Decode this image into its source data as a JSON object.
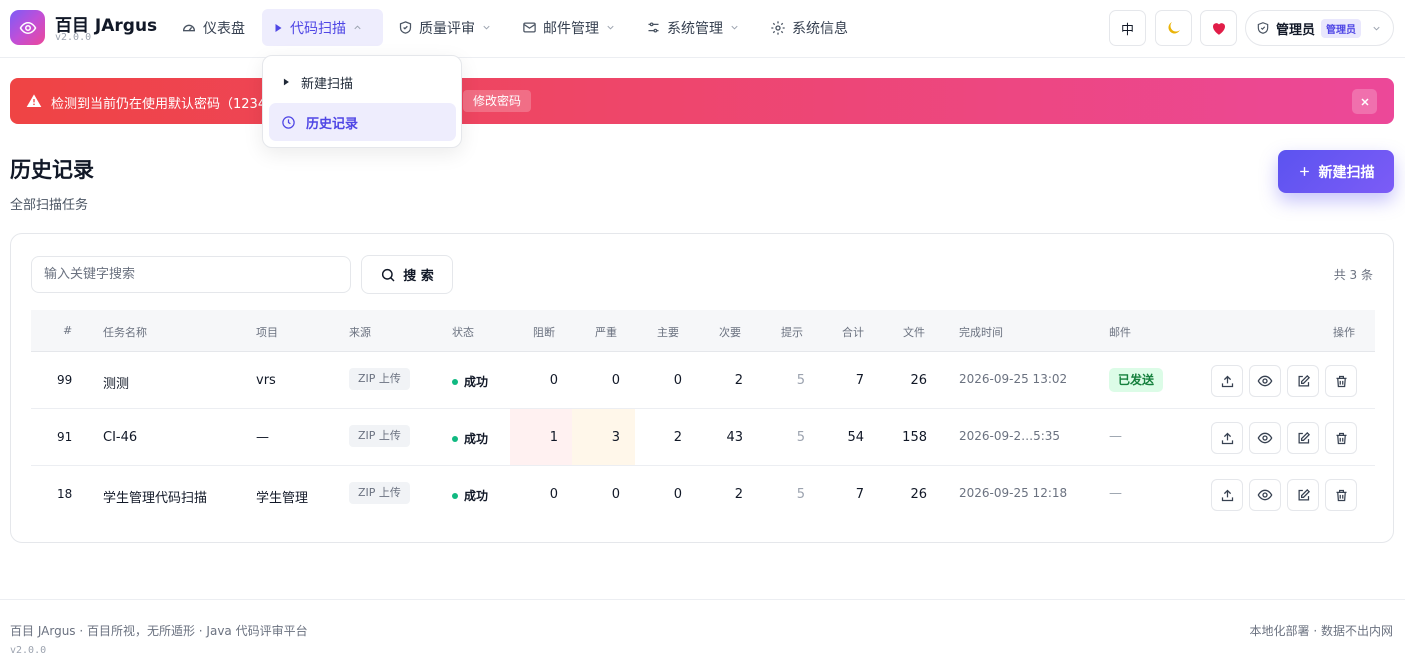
{
  "brand": {
    "name": "百目 JArgus",
    "version": "v2.0.0"
  },
  "nav": [
    {
      "label": "仪表盘"
    },
    {
      "label": "代码扫描"
    },
    {
      "label": "质量评审"
    },
    {
      "label": "邮件管理"
    },
    {
      "label": "系统管理"
    },
    {
      "label": "系统信息"
    }
  ],
  "header": {
    "lang": "中",
    "user": "管理员",
    "role": "管理员"
  },
  "dropdown": [
    {
      "label": "新建扫描"
    },
    {
      "label": "历史记录"
    }
  ],
  "alert": {
    "text": "检测到当前仍在使用默认密码（1234",
    "button": "修改密码"
  },
  "page": {
    "title": "历史记录",
    "subtitle": "全部扫描任务",
    "new_scan": "新建扫描"
  },
  "search": {
    "placeholder": "输入关键字搜索",
    "button": "搜 索",
    "total": "共 3 条"
  },
  "table": {
    "headers": {
      "id": "#",
      "name": "任务名称",
      "project": "项目",
      "source": "来源",
      "status": "状态",
      "blocker": "阻断",
      "critical": "严重",
      "major": "主要",
      "minor": "次要",
      "info": "提示",
      "total": "合计",
      "files": "文件",
      "finished": "完成时间",
      "mail": "邮件",
      "actions": "操作"
    },
    "rows": [
      {
        "id": "99",
        "name": "测测",
        "project": "vrs",
        "source": "ZIP 上传",
        "status": "成功",
        "blocker": "0",
        "critical": "0",
        "major": "0",
        "minor": "2",
        "info": "5",
        "total": "7",
        "files": "26",
        "finished": "2026-09-25 13:02",
        "mail": "已发送"
      },
      {
        "id": "91",
        "name": "CI-46",
        "project": "—",
        "source": "ZIP 上传",
        "status": "成功",
        "blocker": "1",
        "critical": "3",
        "major": "2",
        "minor": "43",
        "info": "5",
        "total": "54",
        "files": "158",
        "finished": "2026-09-2…5:35",
        "mail": "—"
      },
      {
        "id": "18",
        "name": "学生管理代码扫描",
        "project": "学生管理",
        "source": "ZIP 上传",
        "status": "成功",
        "blocker": "0",
        "critical": "0",
        "major": "0",
        "minor": "2",
        "info": "5",
        "total": "7",
        "files": "26",
        "finished": "2026-09-25 12:18",
        "mail": "—"
      }
    ]
  },
  "footer": {
    "left": "百目 JArgus · 百目所视，无所遁形 · Java 代码评审平台",
    "version": "v2.0.0",
    "right": "本地化部署 · 数据不出内网"
  },
  "colors": {
    "accent": "#4f46e5",
    "alert_start": "#ef4444",
    "alert_end": "#ec4899",
    "success": "#10b981"
  }
}
